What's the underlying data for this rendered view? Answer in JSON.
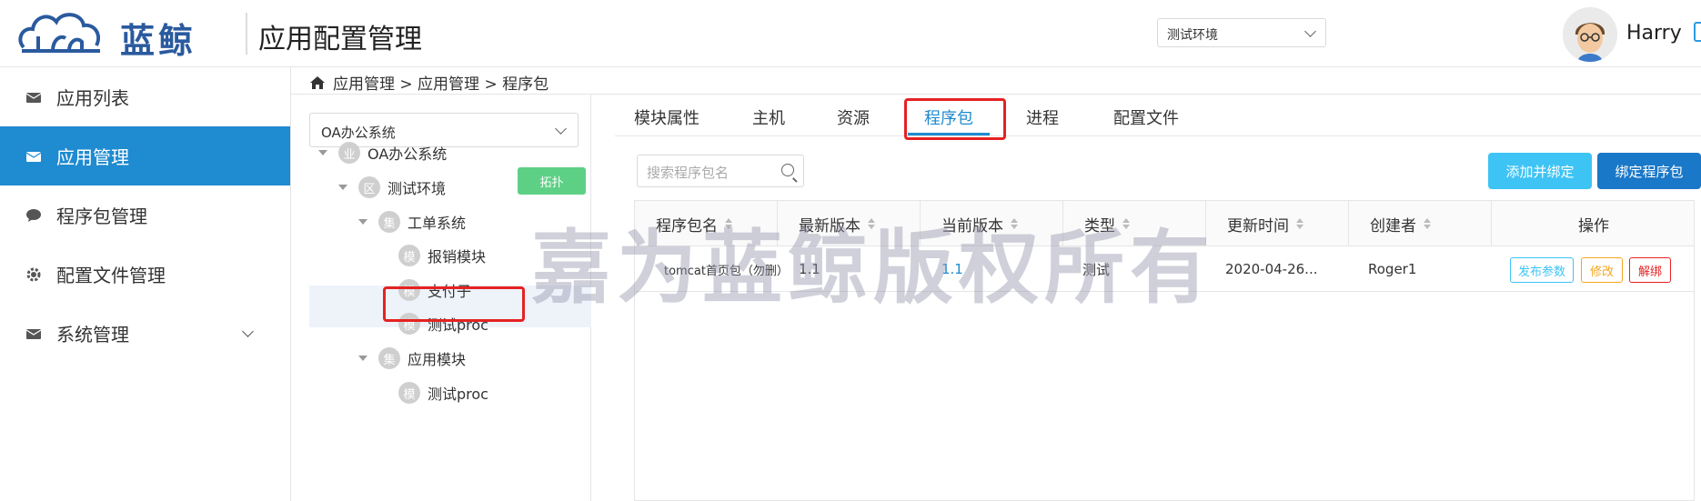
{
  "header": {
    "logo_text": "蓝鲸",
    "app_title": "应用配置管理",
    "env_select_value": "测试环境",
    "username": "Harry"
  },
  "sidebar": {
    "items": [
      {
        "label": "应用列表",
        "icon": "mail-icon",
        "active": false
      },
      {
        "label": "应用管理",
        "icon": "mail-icon",
        "active": true
      },
      {
        "label": "程序包管理",
        "icon": "chat-bubble-icon",
        "active": false
      },
      {
        "label": "配置文件管理",
        "icon": "gear-icon",
        "active": false
      },
      {
        "label": "系统管理",
        "icon": "mail-icon",
        "active": false,
        "expandable": true
      }
    ]
  },
  "breadcrumb": {
    "text": "应用管理 > 应用管理 > 程序包"
  },
  "tree": {
    "system_select_value": "OA办公系统",
    "topo_button": "拓扑",
    "nodes": [
      {
        "badge": "业",
        "label": "OA办公系统",
        "level": 0,
        "caret": true
      },
      {
        "badge": "区",
        "label": "测试环境",
        "level": 1,
        "caret": true
      },
      {
        "badge": "集",
        "label": "工单系统",
        "level": 2,
        "caret": true
      },
      {
        "badge": "模",
        "label": "报销模块",
        "level": 3,
        "caret": false,
        "selected": true
      },
      {
        "badge": "模",
        "label": "支付子",
        "level": 3,
        "caret": false
      },
      {
        "badge": "模",
        "label": "测试proc",
        "level": 3,
        "caret": false
      },
      {
        "badge": "集",
        "label": "应用模块",
        "level": 2,
        "caret": true
      },
      {
        "badge": "模",
        "label": "测试proc",
        "level": 3,
        "caret": false
      }
    ]
  },
  "tabs": [
    "模块属性",
    "主机",
    "资源",
    "程序包",
    "进程",
    "配置文件"
  ],
  "active_tab": "程序包",
  "toolbar": {
    "search_placeholder": "搜索程序包名",
    "add_bind_label": "添加并绑定",
    "bind_label": "绑定程序包"
  },
  "table": {
    "columns": [
      "程序包名",
      "最新版本",
      "当前版本",
      "类型",
      "更新时间",
      "创建者",
      "操作"
    ],
    "rows": [
      {
        "name": "tomcat首页包（勿删）",
        "latest": "1.1",
        "current": "1.1",
        "type": "测试",
        "updated": "2020-04-26...",
        "creator": "Roger1",
        "actions": [
          "发布参数",
          "修改",
          "解绑"
        ]
      }
    ]
  },
  "watermark": "嘉为蓝鲸版权所有",
  "colors": {
    "primary": "#1f8bd0",
    "accent_light": "#3ec3f5",
    "topo_green": "#5ed085",
    "highlight_red": "#e52222",
    "edit_orange": "#f5a623"
  }
}
